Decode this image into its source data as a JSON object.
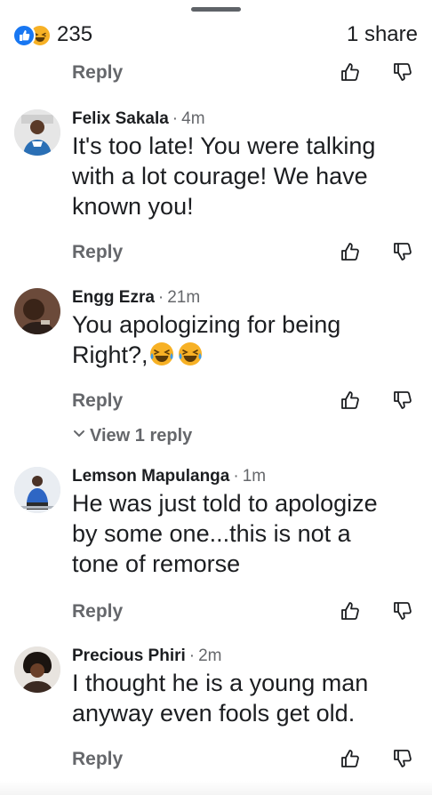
{
  "summary": {
    "reaction_count": "235",
    "share_text": "1 share",
    "reaction_icons": [
      "like-icon",
      "haha-icon"
    ]
  },
  "actions": {
    "reply_label": "Reply",
    "like_icon": "thumbs-up-icon",
    "dislike_icon": "thumbs-down-icon"
  },
  "comments": [
    {
      "author": "Felix Sakala",
      "time": "4m",
      "lines": [
        "It's too late! You were talking",
        "with a lot courage! We have",
        "known you!"
      ]
    },
    {
      "author": "Engg Ezra",
      "time": "21m",
      "lines": [
        "You apologizing for being",
        "Right?,"
      ],
      "emojis": [
        "laughing-tears-emoji",
        "laughing-tears-emoji"
      ],
      "view_replies": "View 1 reply"
    },
    {
      "author": "Lemson Mapulanga",
      "time": "1m",
      "lines": [
        "He was just told to apologize",
        "by some one...this is not a",
        "tone of remorse"
      ]
    },
    {
      "author": "Precious Phiri",
      "time": "2m",
      "lines": [
        "I thought he is a young man",
        "anyway even fools get old."
      ]
    }
  ],
  "colors": {
    "text": "#1c1e21",
    "secondary": "#65676b",
    "like_blue": "#1877f2",
    "haha_yellow": "#f7b125"
  }
}
